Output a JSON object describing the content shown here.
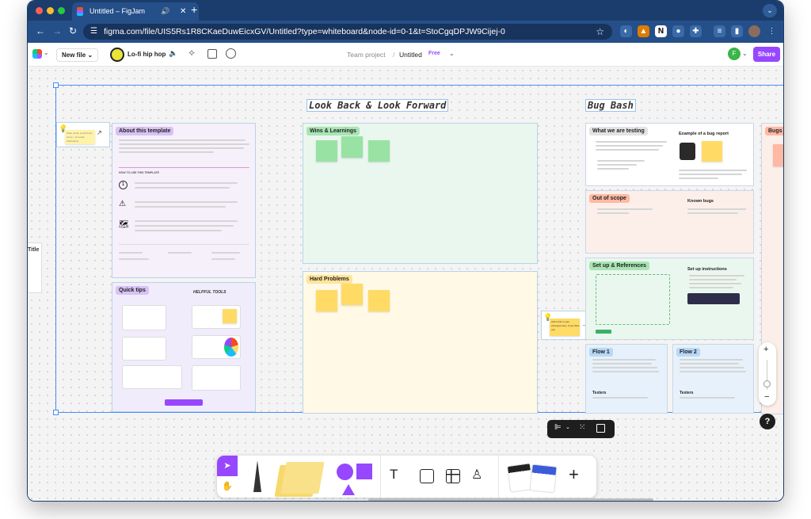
{
  "browser": {
    "tab_title": "Untitled – FigJam",
    "tab_sound_icon": "speaker-icon",
    "new_tab": "+",
    "url": "figma.com/file/UIS5Rs1R8CKaeDuwEicxGV/Untitled?type=whiteboard&node-id=0-1&t=StoCgqDPJW9Cijej-0"
  },
  "toolbar": {
    "new_file": "New file",
    "music": "Lo-fi hip hop",
    "team": "Team project",
    "sep": "/",
    "file_name": "Untitled",
    "plan_badge": "Free",
    "avatar_letter": "F",
    "share": "Share"
  },
  "canvas": {
    "side_label": "Title",
    "heading_look": "Look Back & Look Forward",
    "heading_bug": "Bug Bash",
    "sections": {
      "about": "About this template",
      "quick_tips": "Quick tips",
      "wins": "Wins & Learnings",
      "hard": "Hard Problems",
      "testing": "What we are testing",
      "example": "Example of a bug report",
      "scope": "Out of scope",
      "known": "Known bugs",
      "setup": "Set up & References",
      "setup_instr": "Set up instructions",
      "flow1": "Flow 1",
      "flow2": "Flow 2",
      "testers": "Testers",
      "bugs": "Bugs"
    },
    "note_left": "Click, scroll, or pinch the zoom ○ to reveal instructions",
    "note_right": "Add a link to your prototype here, if you have one",
    "quick_tips_tools": "HELPFUL TOOLS",
    "about_subhead": "HOW TO USE THIS TEMPLATE"
  },
  "colors": {
    "accent": "#9747ff",
    "share": "#9747ff",
    "wins_bg": "#eaf7ee",
    "hard_bg": "#fff9e6",
    "sticky_green": "#98e3a3",
    "sticky_yellow": "#ffdb66"
  },
  "icons": [
    "pointer-icon",
    "hand-icon",
    "pen-icon",
    "sticky-note-icon",
    "shapes-icon",
    "text-icon",
    "section-icon",
    "table-icon",
    "stamp-icon",
    "templates-icon",
    "plus-icon",
    "zoom-in-icon",
    "zoom-out-icon",
    "help-icon"
  ]
}
